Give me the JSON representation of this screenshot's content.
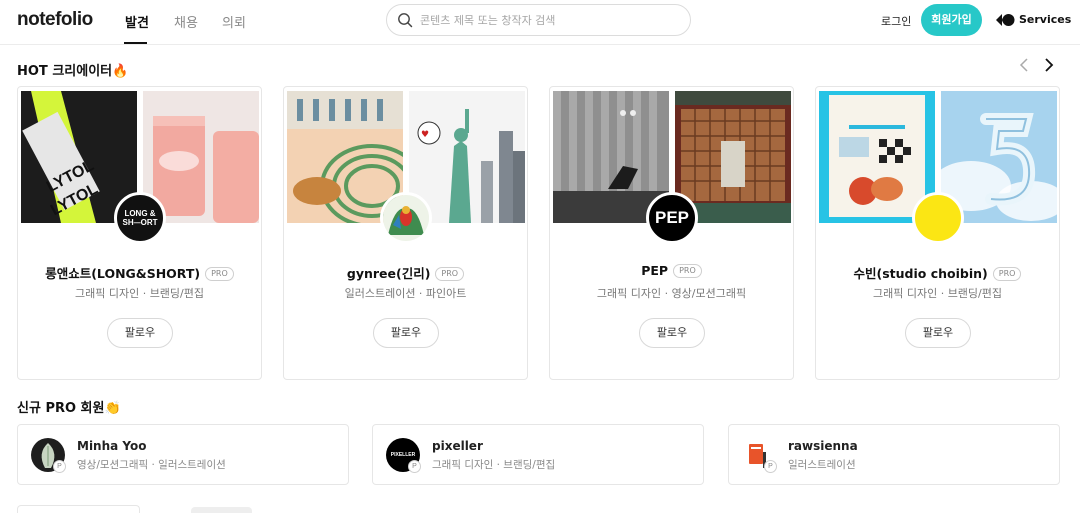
{
  "header": {
    "logo": "notefolio",
    "tabs": [
      {
        "label": "발견",
        "active": true
      },
      {
        "label": "채용",
        "active": false
      },
      {
        "label": "의뢰",
        "active": false
      }
    ],
    "search_placeholder": "콘텐츠 제목 또는 창작자 검색",
    "login_label": "로그인",
    "signup_label": "회원가입",
    "services_label": "Services",
    "accent_color": "#27c8c8"
  },
  "hot": {
    "title": "HOT 크리에이터🔥",
    "prev_icon": "chevron-left-icon",
    "next_icon": "chevron-right-icon",
    "follow_label": "팔로우",
    "pro_label": "PRO",
    "creators": [
      {
        "name": "롱앤쇼트(LONG&SHORT)",
        "categories": "그래픽 디자인 · 브랜딩/편집",
        "avatar_text": "LONG & SHORT"
      },
      {
        "name": "gynree(긴리)",
        "categories": "일러스트레이션 · 파인아트",
        "avatar_text": ""
      },
      {
        "name": "PEP",
        "categories": "그래픽 디자인 · 영상/모션그래픽",
        "avatar_text": "PEP"
      },
      {
        "name": "수빈(studio choibin)",
        "categories": "그래픽 디자인 · 브랜딩/편집",
        "avatar_text": ""
      }
    ]
  },
  "new_pro": {
    "title": "신규 PRO 회원👏",
    "pro_mini": "P",
    "members": [
      {
        "name": "Minha Yoo",
        "categories": "영상/모션그래픽 · 일러스트레이션"
      },
      {
        "name": "pixeller",
        "categories": "그래픽 디자인 · 브랜딩/편집",
        "avatar_text": "PIXELLER"
      },
      {
        "name": "rawsienna",
        "categories": "일러스트레이션"
      }
    ]
  }
}
